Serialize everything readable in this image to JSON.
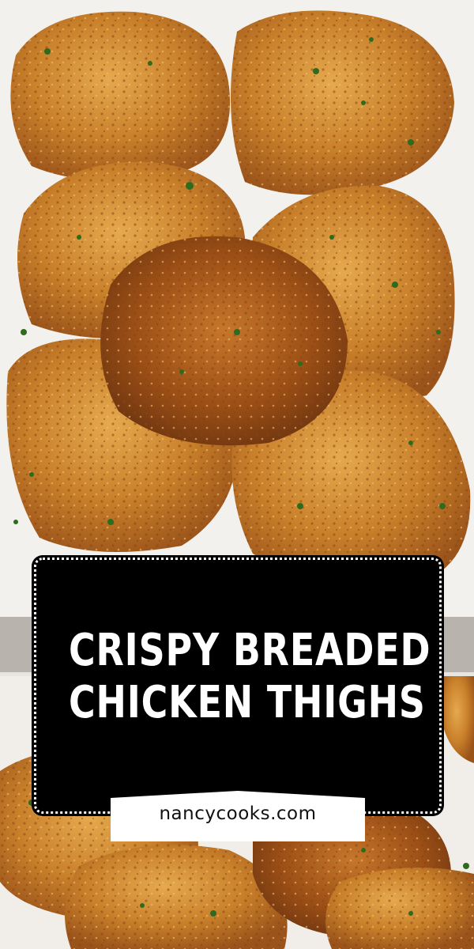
{
  "title": {
    "line1": "CRISPY BREADED",
    "line2": "CHICKEN THIGHS"
  },
  "website": "nancycooks.com",
  "colors": {
    "card_background": "#000000",
    "card_text": "#ffffff",
    "banner_background": "#ffffff",
    "chicken_crust": "#c9802a",
    "chicken_dark": "#8a4512",
    "parsley": "#2f6b1f",
    "plate": "#f3f1ee"
  }
}
